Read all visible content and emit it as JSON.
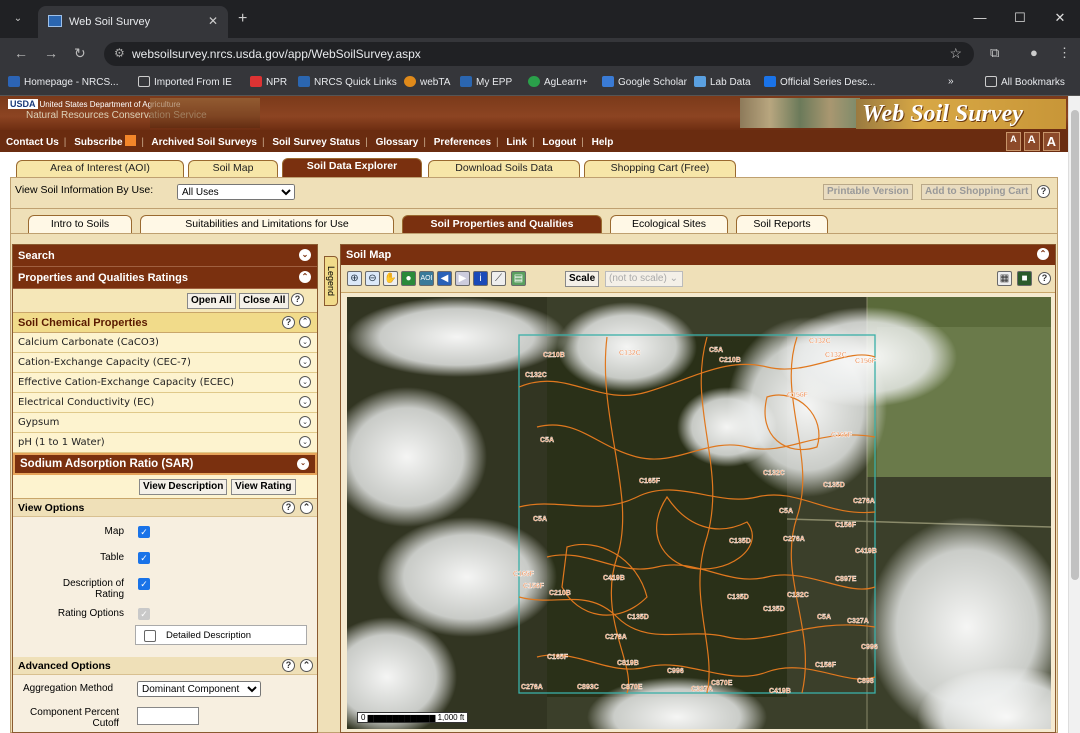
{
  "browser": {
    "tab_title": "Web Soil Survey",
    "url": "websoilsurvey.nrcs.usda.gov/app/WebSoilSurvey.aspx",
    "bookmarks": [
      "Homepage - NRCS...",
      "Imported From IE",
      "NPR",
      "NRCS Quick Links",
      "webTA",
      "My EPP",
      "AgLearn+",
      "Google Scholar",
      "Lab Data",
      "Official Series Desc..."
    ],
    "all_bookmarks": "All Bookmarks",
    "overflow": "»"
  },
  "banner": {
    "usda_line": "United States Department of Agriculture",
    "usda_badge": "USDA",
    "agency": "Natural Resources Conservation Service",
    "brand": "Web Soil Survey"
  },
  "menu": [
    "Contact Us",
    "Subscribe",
    "Archived Soil Surveys",
    "Soil Survey Status",
    "Glossary",
    "Preferences",
    "Link",
    "Logout",
    "Help"
  ],
  "font_sizes": [
    "A",
    "A",
    "A"
  ],
  "main_tabs": [
    "Area of Interest (AOI)",
    "Soil Map",
    "Soil Data Explorer",
    "Download Soils Data",
    "Shopping Cart (Free)"
  ],
  "view_by": {
    "label": "View Soil Information By Use:",
    "value": "All Uses"
  },
  "printable": "Printable Version",
  "add_cart": "Add to Shopping Cart",
  "sub_tabs": [
    "Intro to Soils",
    "Suitabilities and Limitations for Use",
    "Soil Properties and Qualities",
    "Ecological Sites",
    "Soil Reports"
  ],
  "left": {
    "search": "Search",
    "ratings": "Properties and Qualities Ratings",
    "open_all": "Open All",
    "close_all": "Close All",
    "category": "Soil Chemical Properties",
    "items": [
      "Calcium Carbonate (CaCO3)",
      "Cation-Exchange Capacity (CEC-7)",
      "Effective Cation-Exchange Capacity (ECEC)",
      "Electrical Conductivity (EC)",
      "Gypsum",
      "pH (1 to 1 Water)"
    ],
    "selected": "Sodium Adsorption Ratio (SAR)",
    "view_description": "View Description",
    "view_rating": "View Rating",
    "view_options": "View Options",
    "opt_map": "Map",
    "opt_table": "Table",
    "opt_desc": "Description of Rating",
    "opt_rating": "Rating Options",
    "detailed": "Detailed Description",
    "advanced": "Advanced Options",
    "agg_label": "Aggregation Method",
    "agg_value": "Dominant Component",
    "cutoff_label": "Component Percent Cutoff"
  },
  "map": {
    "title": "Soil Map",
    "legend": "Legend",
    "scale_btn": "Scale",
    "scale_value": "(not to scale)",
    "scalebar": "0 ▆▆▆▆▆▆▆▆▆▆▆ 1,000 ft",
    "labels": [
      "C210B",
      "C132C",
      "C5A",
      "C210B",
      "C132C",
      "C132C",
      "C156F",
      "C132C",
      "C156F",
      "C5A",
      "C165F",
      "C132C",
      "C165F",
      "C135D",
      "C276A",
      "C5A",
      "C5A",
      "C156F",
      "C135D",
      "C276A",
      "C419B",
      "C165F",
      "C156F",
      "C419B",
      "C210B",
      "C132C",
      "C897E",
      "C135D",
      "C135D",
      "C5A",
      "C327A",
      "C276A",
      "C135D",
      "C165F",
      "C819B",
      "C996",
      "C996",
      "C276A",
      "C893C",
      "C870E",
      "C870E",
      "C327A",
      "C156F",
      "C419B",
      "C898"
    ]
  }
}
